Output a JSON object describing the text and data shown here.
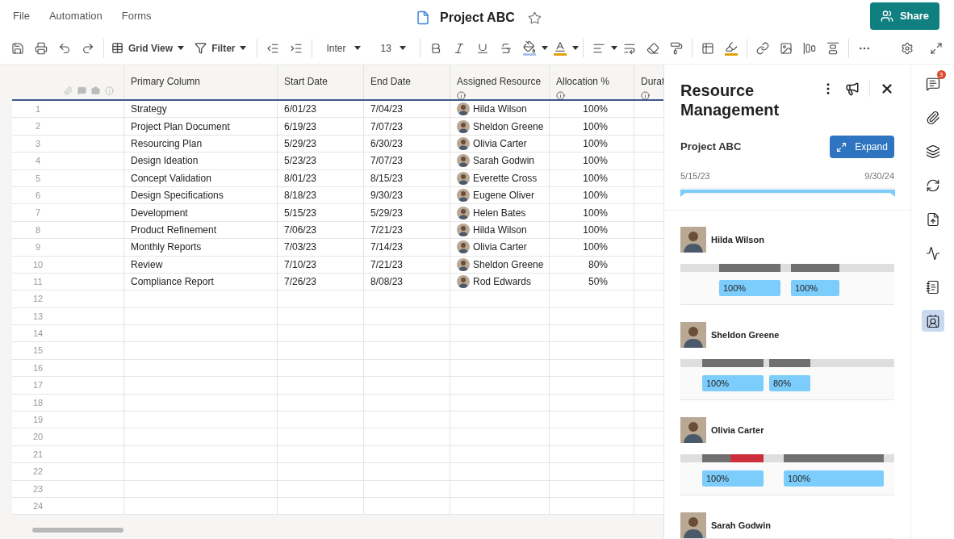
{
  "menu": [
    {
      "label": "File"
    },
    {
      "label": "Automation"
    },
    {
      "label": "Forms"
    }
  ],
  "title": "Project ABC",
  "favorite": false,
  "share": "Share",
  "toolbar": {
    "view": "Grid View",
    "filter": "Filter",
    "font": "Inter",
    "size": "13"
  },
  "grid": {
    "columns": [
      {
        "label": "Primary Column",
        "info": false
      },
      {
        "label": "Start Date",
        "info": false
      },
      {
        "label": "End Date",
        "info": false
      },
      {
        "label": "Assigned Resource",
        "info": true
      },
      {
        "label": "Allocation %",
        "info": true
      },
      {
        "label": "Durat",
        "info": true
      }
    ],
    "rows": [
      {
        "number": "1",
        "cells": [
          "Strategy",
          "6/01/23",
          "7/04/23",
          "Hilda Wilson",
          "100%"
        ]
      },
      {
        "number": "2",
        "cells": [
          "Project Plan Document",
          "6/19/23",
          "7/07/23",
          "Sheldon Greene",
          "100%"
        ]
      },
      {
        "number": "3",
        "cells": [
          "Resourcing Plan",
          "5/29/23",
          "6/30/23",
          "Olivia Carter",
          "100%"
        ]
      },
      {
        "number": "4",
        "cells": [
          "Design Ideation",
          "5/23/23",
          "7/07/23",
          "Sarah Godwin",
          "100%"
        ]
      },
      {
        "number": "5",
        "cells": [
          "Concept Validation",
          "8/01/23",
          "8/15/23",
          "Everette Cross",
          "100%"
        ]
      },
      {
        "number": "6",
        "cells": [
          "Design Specifications",
          "8/18/23",
          "9/30/23",
          "Eugene Oliver",
          "100%"
        ]
      },
      {
        "number": "7",
        "cells": [
          "Development",
          "5/15/23",
          "5/29/23",
          "Helen Bates",
          "100%"
        ]
      },
      {
        "number": "8",
        "cells": [
          "Product Refinement",
          "7/06/23",
          "7/21/23",
          "Hilda Wilson",
          "100%"
        ]
      },
      {
        "number": "9",
        "cells": [
          "Monthly Reports",
          "7/03/23",
          "7/14/23",
          "Olivia Carter",
          "100%"
        ]
      },
      {
        "number": "10",
        "cells": [
          "Review",
          "7/10/23",
          "7/21/23",
          "Sheldon Greene",
          "80%"
        ]
      },
      {
        "number": "11",
        "cells": [
          "Compliance Report",
          "7/26/23",
          "8/08/23",
          "Rod Edwards",
          "50%"
        ]
      },
      {
        "number": "12",
        "cells": []
      },
      {
        "number": "13",
        "cells": []
      },
      {
        "number": "14",
        "cells": []
      },
      {
        "number": "15",
        "cells": []
      },
      {
        "number": "16",
        "cells": []
      },
      {
        "number": "17",
        "cells": []
      },
      {
        "number": "18",
        "cells": []
      },
      {
        "number": "19",
        "cells": []
      },
      {
        "number": "20",
        "cells": []
      },
      {
        "number": "21",
        "cells": []
      },
      {
        "number": "22",
        "cells": []
      },
      {
        "number": "23",
        "cells": []
      },
      {
        "number": "24",
        "cells": []
      }
    ]
  },
  "panel": {
    "title": "Resource Management",
    "project": "Project ABC",
    "expand": "Expand",
    "start": "5/15/23",
    "end": "9/30/24",
    "people": [
      {
        "name": "Hilda Wilson",
        "bars": [
          {
            "color": "#707070"
          },
          {
            "color": "#707070"
          }
        ],
        "labels": [
          "100%",
          "100%"
        ]
      },
      {
        "name": "Sheldon Greene",
        "bars": [
          {
            "color": "#707070"
          },
          {
            "color": "#707070"
          }
        ],
        "labels": [
          "100%",
          "80%"
        ]
      },
      {
        "name": "Olivia Carter",
        "bars": [
          {
            "color": "#707070"
          },
          {
            "color": "#cc2e3b"
          },
          {
            "color": "#707070"
          }
        ],
        "labels": [
          "100%",
          "100%"
        ]
      },
      {
        "name": "Sarah Godwin"
      }
    ]
  },
  "rail": [
    {
      "kind": "comments",
      "badge": "3",
      "selected": false
    },
    {
      "kind": "attachments",
      "selected": false
    },
    {
      "kind": "proofs",
      "selected": false
    },
    {
      "kind": "updates",
      "selected": false
    },
    {
      "kind": "publish",
      "selected": false
    },
    {
      "kind": "activity",
      "selected": false
    },
    {
      "kind": "summary",
      "selected": false
    },
    {
      "kind": "resources",
      "selected": true
    }
  ]
}
